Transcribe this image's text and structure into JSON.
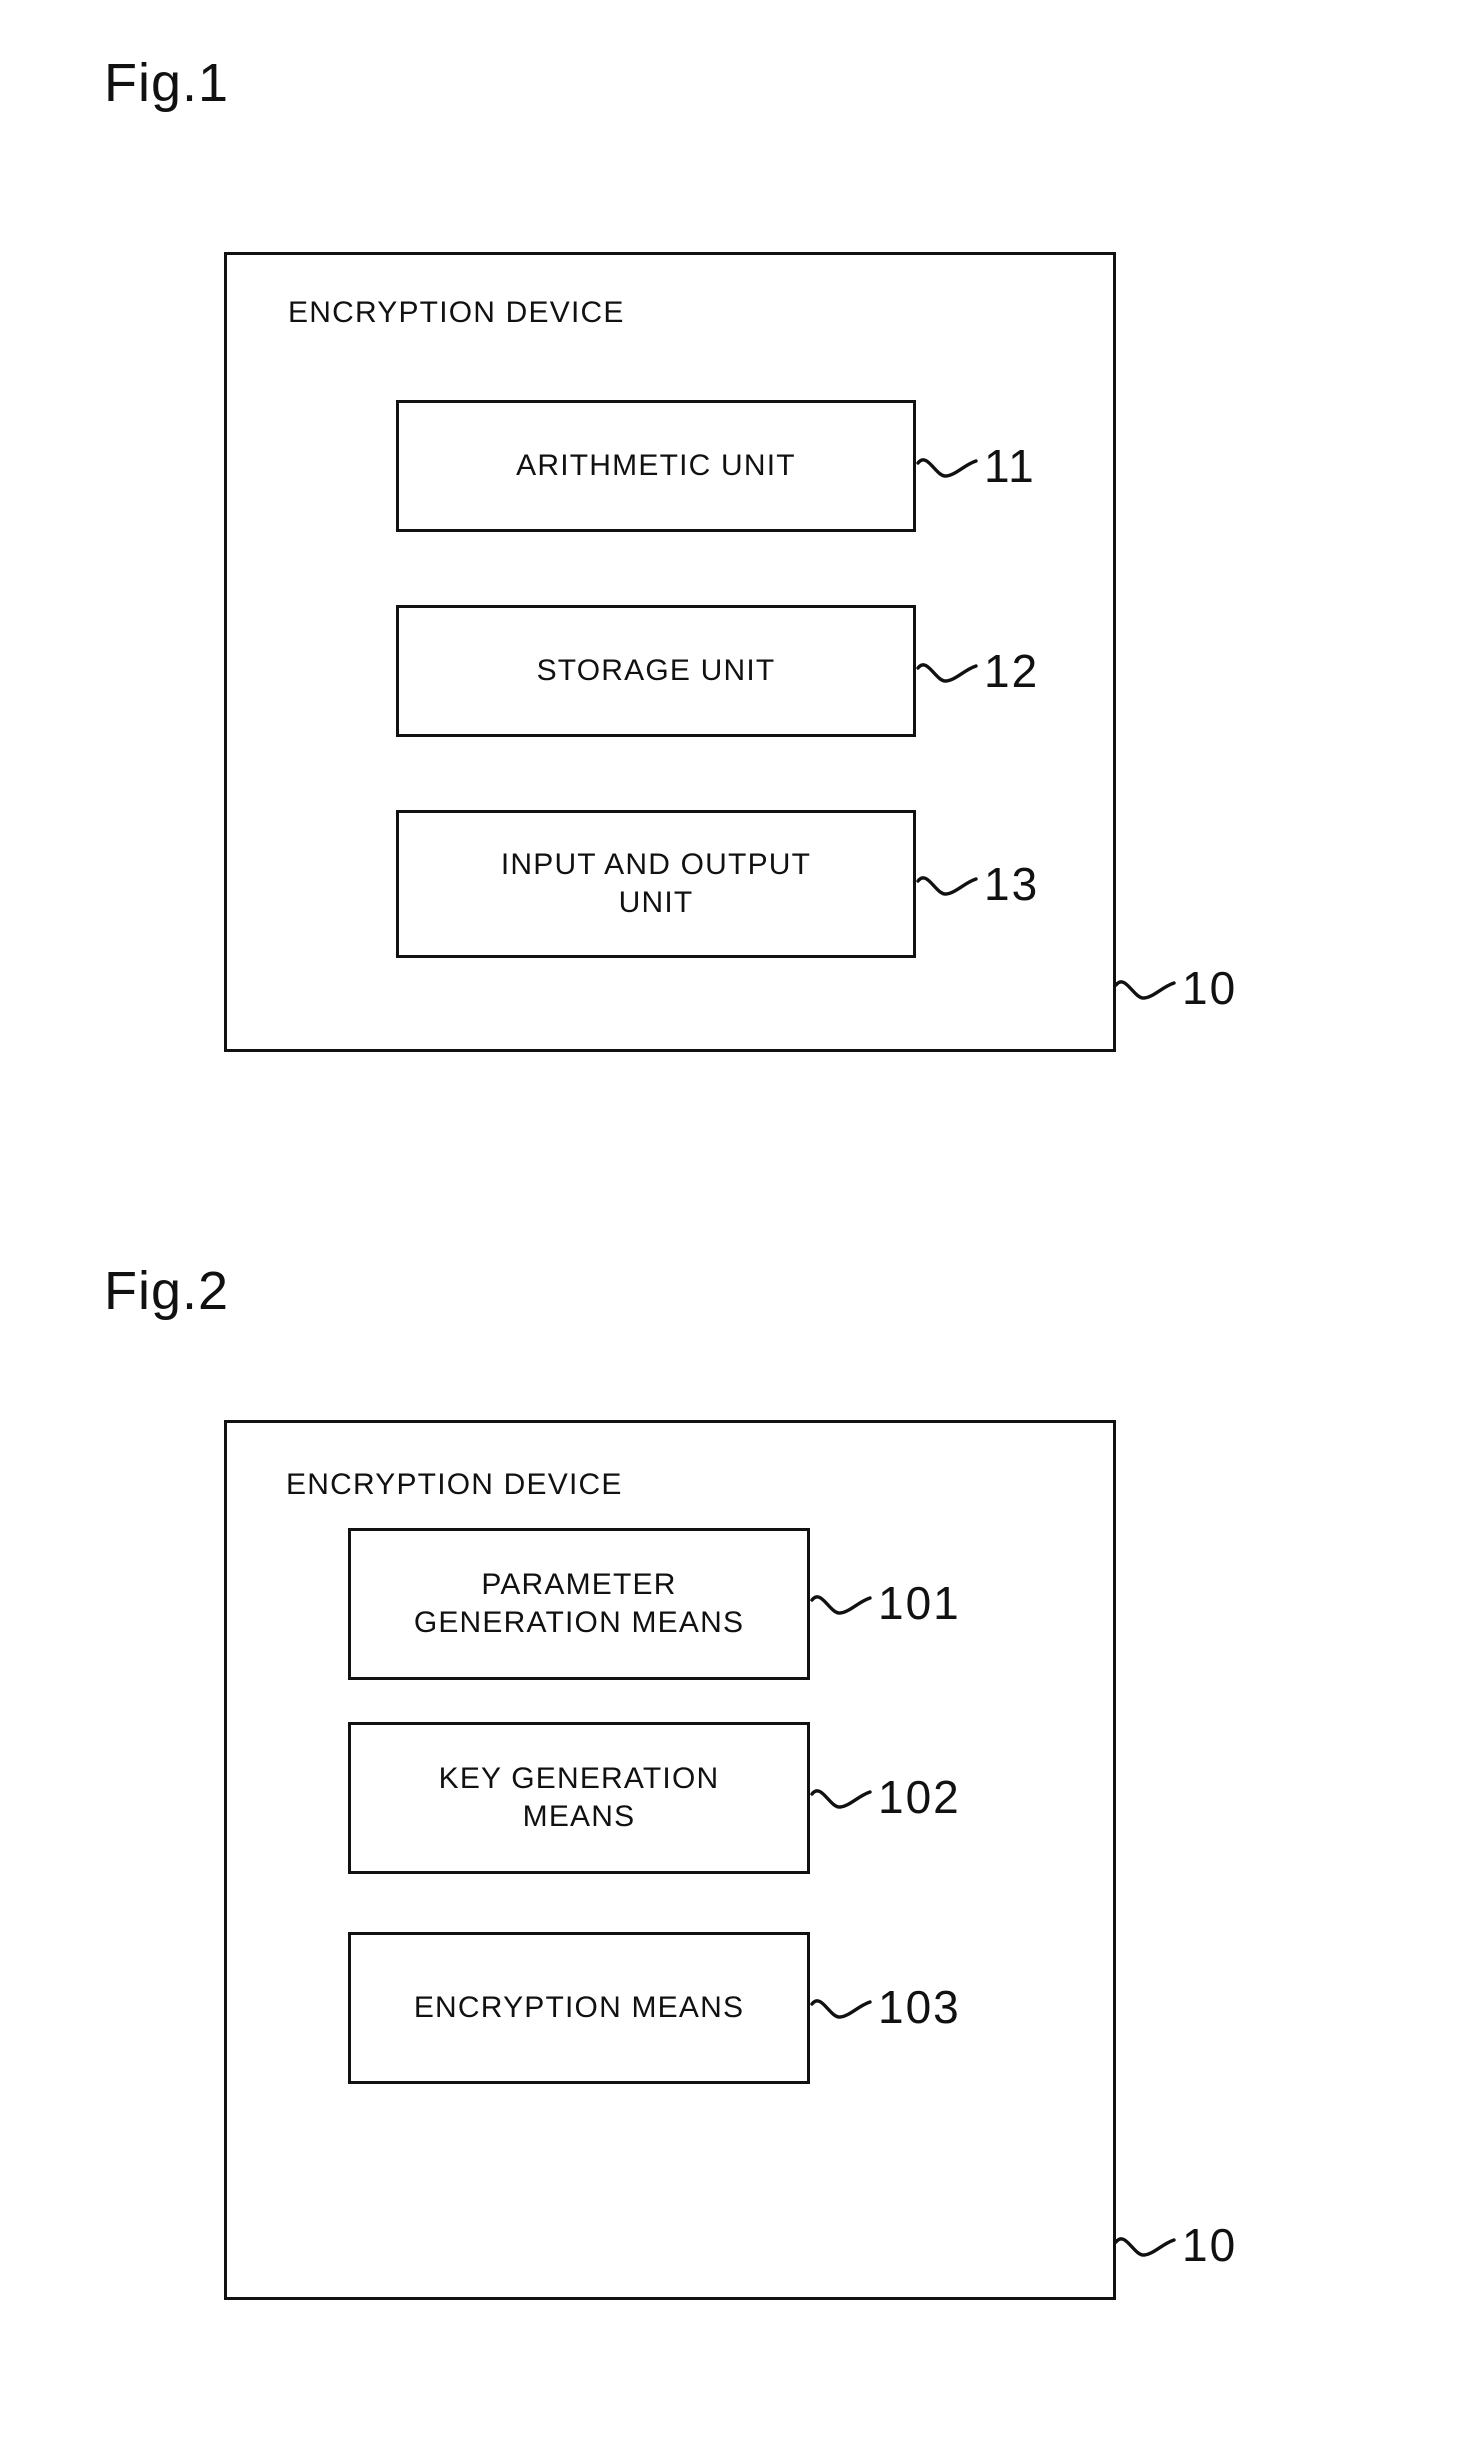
{
  "page": {
    "background": "#ffffff",
    "ink_color": "#111111"
  },
  "figures": [
    {
      "id": "fig-1",
      "label": "Fig.1",
      "device": {
        "title": "ENCRYPTION DEVICE",
        "ref": "10"
      },
      "modules": [
        {
          "label": "ARITHMETIC UNIT",
          "ref": "11"
        },
        {
          "label": "STORAGE UNIT",
          "ref": "12"
        },
        {
          "label": "INPUT AND OUTPUT\nUNIT",
          "ref": "13"
        }
      ]
    },
    {
      "id": "fig-2",
      "label": "Fig.2",
      "device": {
        "title": "ENCRYPTION DEVICE",
        "ref": "10"
      },
      "modules": [
        {
          "label": "PARAMETER\nGENERATION MEANS",
          "ref": "101"
        },
        {
          "label": "KEY GENERATION\nMEANS",
          "ref": "102"
        },
        {
          "label": "ENCRYPTION MEANS",
          "ref": "103"
        }
      ]
    }
  ]
}
